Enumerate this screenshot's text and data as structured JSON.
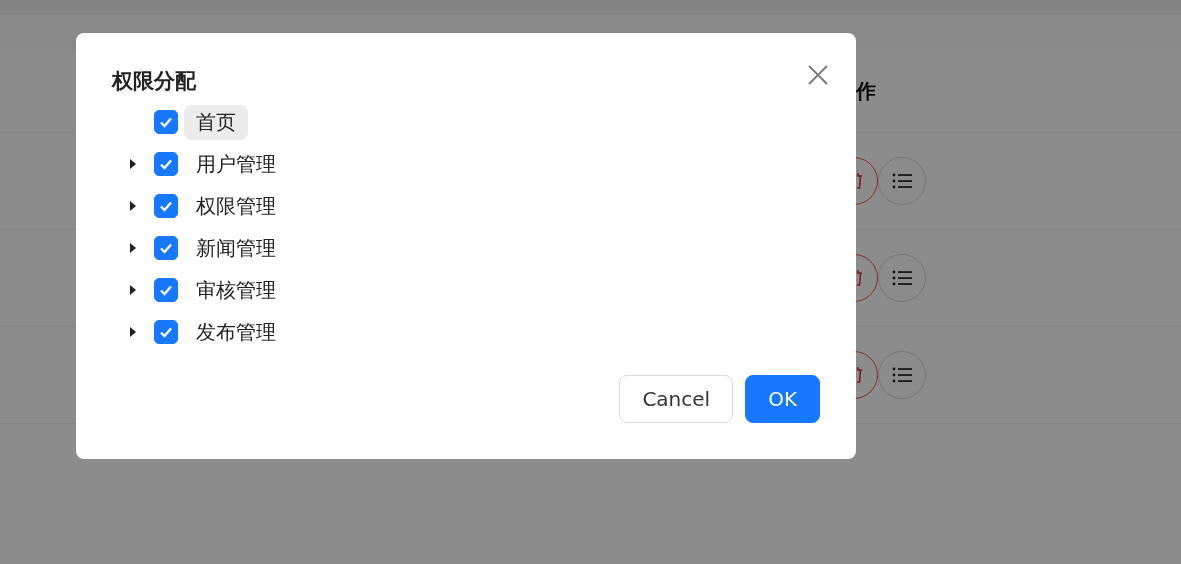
{
  "table": {
    "columns": [
      {
        "label": "作"
      }
    ],
    "rows": [
      {
        "actions": [
          {
            "kind": "delete"
          },
          {
            "kind": "list"
          }
        ]
      },
      {
        "actions": [
          {
            "kind": "delete"
          },
          {
            "kind": "list"
          }
        ]
      },
      {
        "actions": [
          {
            "kind": "delete"
          },
          {
            "kind": "list"
          }
        ]
      }
    ]
  },
  "modal": {
    "title": "权限分配",
    "tree": [
      {
        "label": "首页",
        "kind": "leaf",
        "checked": true,
        "selected": true
      },
      {
        "label": "用户管理",
        "kind": "parent",
        "checked": true,
        "selected": false
      },
      {
        "label": "权限管理",
        "kind": "parent",
        "checked": true,
        "selected": false
      },
      {
        "label": "新闻管理",
        "kind": "parent",
        "checked": true,
        "selected": false
      },
      {
        "label": "审核管理",
        "kind": "parent",
        "checked": true,
        "selected": false
      },
      {
        "label": "发布管理",
        "kind": "parent",
        "checked": true,
        "selected": false
      }
    ],
    "buttons": [
      {
        "label": "Cancel",
        "kind": "default"
      },
      {
        "label": "OK",
        "kind": "primary"
      }
    ]
  }
}
